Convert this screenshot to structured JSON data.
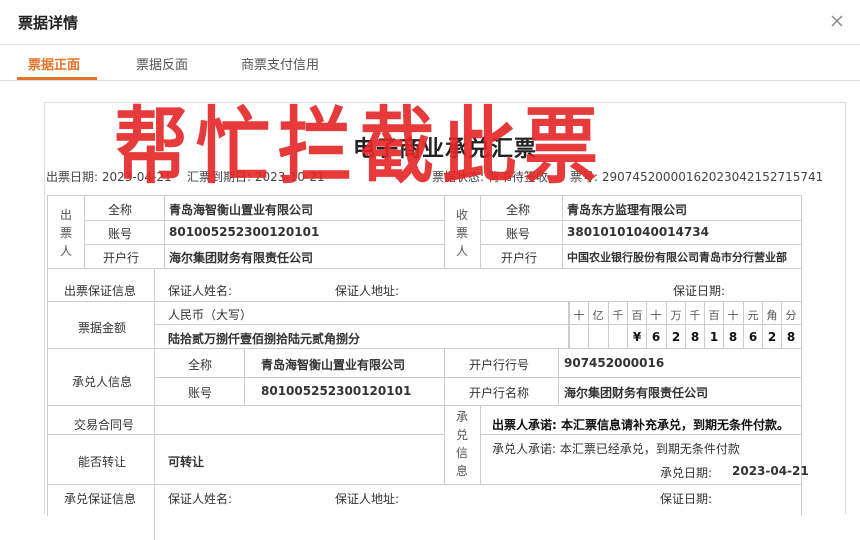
{
  "dialog": {
    "title": "票据详情"
  },
  "tabs": [
    "票据正面",
    "票据反面",
    "商票支付信用"
  ],
  "watermark": "帮忙拦截此票",
  "bill": {
    "title": "电子商业承兑汇票",
    "issue_date": "出票日期:  2023-04-21",
    "due_date": "汇票到期日:  2023-10-21",
    "status": "票据状态:  背书待签收",
    "number": "票号:  29074520000162023042152715741"
  },
  "drawer": {
    "section": "出票人",
    "name_label": "全称",
    "name": "青岛海智衡山置业有限公司",
    "account_label": "账号",
    "account": "801005252300120101",
    "bank_label": "开户行",
    "bank": "海尔集团财务有限责任公司"
  },
  "payee": {
    "section": "收票人",
    "name_label": "全称",
    "name": "青岛东方监理有限公司",
    "account_label": "账号",
    "account": "38010101040014734",
    "bank_label": "开户行",
    "bank": "中国农业银行股份有限公司青岛市分行营业部"
  },
  "guarantee": {
    "label": "出票保证信息",
    "name_label": "保证人姓名:",
    "address_label": "保证人地址:",
    "date_label": "保证日期:"
  },
  "amount": {
    "label": "票据金额",
    "currency_label": "人民币（大写）",
    "words": "陆拾贰万捌仟壹佰捌拾陆元贰角捌分",
    "units": [
      "十",
      "亿",
      "千",
      "百",
      "十",
      "万",
      "千",
      "百",
      "十",
      "元",
      "角",
      "分"
    ],
    "digits": [
      "",
      "",
      "",
      "¥",
      "6",
      "2",
      "8",
      "1",
      "8",
      "6",
      "2",
      "8"
    ]
  },
  "acceptor": {
    "label": "承兑人信息",
    "name_label": "全称",
    "name": "青岛海智衡山置业有限公司",
    "account_label": "账号",
    "account": "801005252300120101",
    "bank_no_label": "开户行行号",
    "bank_no": "907452000016",
    "bank_name_label": "开户行名称",
    "bank_name": "海尔集团财务有限责任公司"
  },
  "contract": {
    "label": "交易合同号",
    "value": ""
  },
  "transfer": {
    "label": "能否转让",
    "value": "可转让"
  },
  "acceptance": {
    "section": "承兑信息",
    "drawer_promise": "出票人承诺:  本汇票信息请补充承兑，到期无条件付款。",
    "acceptor_promise": "承兑人承诺:  本汇票已经承兑，到期无条件付款",
    "date_label": "承兑日期:",
    "date": "2023-04-21"
  },
  "accept_guarantee": {
    "label": "承兑保证信息",
    "name_label": "保证人姓名:",
    "address_label": "保证人地址:",
    "date_label": "保证日期:"
  }
}
